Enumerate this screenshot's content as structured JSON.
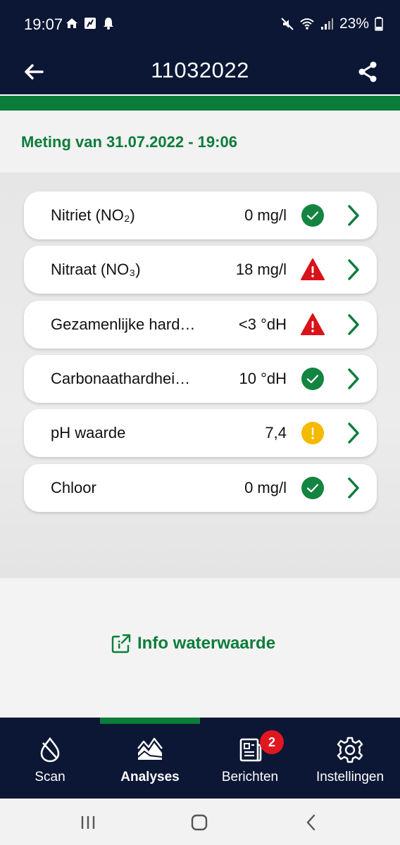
{
  "status_bar": {
    "time": "19:07",
    "battery": "23%",
    "left_icons": [
      "home-icon",
      "activity-icon",
      "alarm-icon"
    ],
    "right_icons": [
      "mute-icon",
      "wifi-icon",
      "signal-icon",
      "battery-icon"
    ]
  },
  "app_bar": {
    "title": "11032022",
    "back_icon": "arrow-left-icon",
    "share_icon": "share-icon"
  },
  "measurement": {
    "label": "Meting van 31.07.2022 - 19:06"
  },
  "results": [
    {
      "name": "Nitriet (NO₂)",
      "value": "0 mg/l",
      "status": "ok"
    },
    {
      "name": "Nitraat (NO₃)",
      "value": "18 mg/l",
      "status": "danger"
    },
    {
      "name": "Gezamenlijke hard…",
      "value": "<3 °dH",
      "status": "danger"
    },
    {
      "name": "Carbonaathardhei…",
      "value": "10 °dH",
      "status": "ok"
    },
    {
      "name": "pH waarde",
      "value": "7,4",
      "status": "warning"
    },
    {
      "name": "Chloor",
      "value": "0 mg/l",
      "status": "ok"
    }
  ],
  "info_link": {
    "label": "Info waterwaarde",
    "icon": "external-link-icon"
  },
  "bottom_nav": {
    "items": [
      {
        "label": "Scan",
        "icon": "water-drop-icon",
        "active": false
      },
      {
        "label": "Analyses",
        "icon": "chart-area-icon",
        "active": true
      },
      {
        "label": "Berichten",
        "icon": "newspaper-icon",
        "active": false,
        "badge": "2"
      },
      {
        "label": "Instellingen",
        "icon": "gear-icon",
        "active": false
      }
    ]
  },
  "colors": {
    "navy": "#0b1734",
    "green": "#0c7c3b",
    "ok": "#148442",
    "danger": "#d9131a",
    "warning": "#f5b900",
    "badge": "#e0171f"
  }
}
